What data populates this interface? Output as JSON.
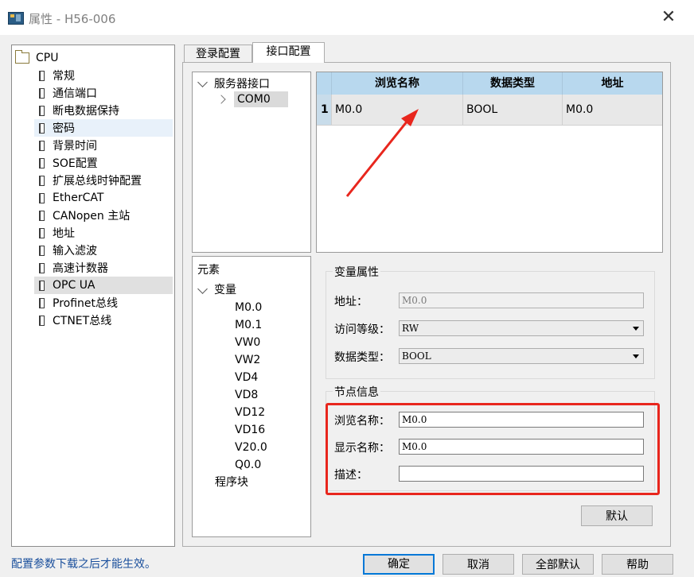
{
  "window": {
    "title": "属性 - H56-006"
  },
  "left_tree": {
    "root": "CPU",
    "items": [
      {
        "label": "常规",
        "state": ""
      },
      {
        "label": "通信端口",
        "state": ""
      },
      {
        "label": "断电数据保持",
        "state": ""
      },
      {
        "label": "密码",
        "state": "hover"
      },
      {
        "label": "背景时间",
        "state": ""
      },
      {
        "label": "SOE配置",
        "state": ""
      },
      {
        "label": "扩展总线时钟配置",
        "state": ""
      },
      {
        "label": "EtherCAT",
        "state": ""
      },
      {
        "label": "CANopen 主站",
        "state": ""
      },
      {
        "label": "地址",
        "state": ""
      },
      {
        "label": "输入滤波",
        "state": ""
      },
      {
        "label": "高速计数器",
        "state": ""
      },
      {
        "label": "OPC UA",
        "state": "selected"
      },
      {
        "label": "Profinet总线",
        "state": ""
      },
      {
        "label": "CTNET总线",
        "state": ""
      }
    ]
  },
  "tabs": [
    {
      "label": "登录配置",
      "active": false
    },
    {
      "label": "接口配置",
      "active": true
    }
  ],
  "server_tree": {
    "root": "服务器接口",
    "child": "COM0"
  },
  "grid": {
    "headers": [
      "浏览名称",
      "数据类型",
      "地址"
    ],
    "rows": [
      {
        "index": "1",
        "browse_name": "M0.0",
        "data_type": "BOOL",
        "address": "M0.0"
      }
    ]
  },
  "elements_tree": {
    "title": "元素",
    "group": "变量",
    "vars": [
      "M0.0",
      "M0.1",
      "VW0",
      "VW2",
      "VD4",
      "VD8",
      "VD12",
      "VD16",
      "V20.0",
      "Q0.0"
    ],
    "other": "程序块"
  },
  "var_props": {
    "title": "变量属性",
    "address_label": "地址：",
    "address_value": "M0.0",
    "access_label": "访问等级：",
    "access_value": "RW",
    "type_label": "数据类型：",
    "type_value": "BOOL"
  },
  "node_info": {
    "title": "节点信息",
    "browse_label": "浏览名称：",
    "browse_value": "M0.0",
    "display_label": "显示名称：",
    "display_value": "M0.0",
    "desc_label": "描述：",
    "desc_value": ""
  },
  "buttons": {
    "default_label": "默认",
    "ok": "确定",
    "cancel": "取消",
    "all_default": "全部默认",
    "help": "帮助"
  },
  "status_text": "配置参数下载之后才能生效。",
  "colors": {
    "grid_header": "#b8d8ee",
    "annotation_red": "#e8261d",
    "status_blue": "#1a4f9c"
  }
}
